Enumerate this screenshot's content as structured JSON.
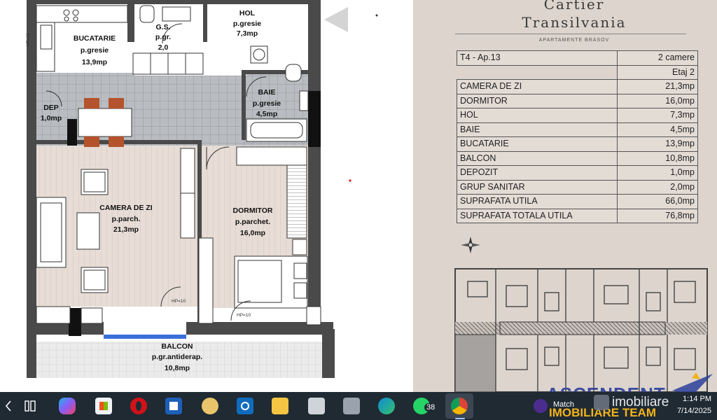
{
  "brand": {
    "line1": "Cartier",
    "line2": "Transilvania",
    "subtitle": "APARTAMENTE BRASOV"
  },
  "table": {
    "header_left": "T4 - Ap.13",
    "header_right": "2 camere",
    "floor": "Etaj 2",
    "rows": [
      {
        "label": "CAMERA DE ZI",
        "value": "21,3mp"
      },
      {
        "label": "DORMITOR",
        "value": "16,0mp"
      },
      {
        "label": "HOL",
        "value": "7,3mp"
      },
      {
        "label": "BAIE",
        "value": "4,5mp"
      },
      {
        "label": "BUCATARIE",
        "value": "13,9mp"
      },
      {
        "label": "BALCON",
        "value": "10,8mp"
      },
      {
        "label": "DEPOZIT",
        "value": "1,0mp"
      },
      {
        "label": "GRUP SANITAR",
        "value": "2,0mp"
      },
      {
        "label": "SUPRAFATA UTILA",
        "value": "66,0mp"
      },
      {
        "label": "SUPRAFATA TOTALA UTILA",
        "value": "76,8mp"
      }
    ]
  },
  "rooms": {
    "bucatarie": {
      "name": "BUCATARIE",
      "floor": "p.gresie",
      "area": "13,9mp"
    },
    "gs": {
      "name": "G.S.",
      "floor": "p.gr.",
      "area": "2,0"
    },
    "hol": {
      "name": "HOL",
      "floor": "p.gresie",
      "area": "7,3mp"
    },
    "baie": {
      "name": "BAIE",
      "floor": "p.gresie",
      "area": "4,5mp"
    },
    "dep": {
      "name": "DEP",
      "area": "1,0mp"
    },
    "camera": {
      "name": "CAMERA DE ZI",
      "floor": "p.parch.",
      "area": "21,3mp"
    },
    "dormitor": {
      "name": "DORMITOR",
      "floor": "p.parchet.",
      "area": "16,0mp"
    },
    "balcon": {
      "name": "BALCON",
      "floor": "p.gr.antiderap.",
      "area": "10,8mp"
    },
    "hp1": "HP=10",
    "hp2": "HP=10",
    "hp3": "HP=10"
  },
  "watermark": {
    "line1": "ASCENDENT",
    "line2": "IMOBILIARE TEAM",
    "site": "imobiliare"
  },
  "taskbar": {
    "badge": "38",
    "match_label": "Match",
    "time": "1:14 PM",
    "date": "7/14/2025"
  },
  "colors": {
    "right_bg": "#dcd4cd",
    "taskbar": "#1f2a33",
    "tile_floor": "#b8bcc0",
    "parquet": "#e6ddd6",
    "chair": "#b5532c",
    "balcony_glass": "#3a6fd8"
  }
}
